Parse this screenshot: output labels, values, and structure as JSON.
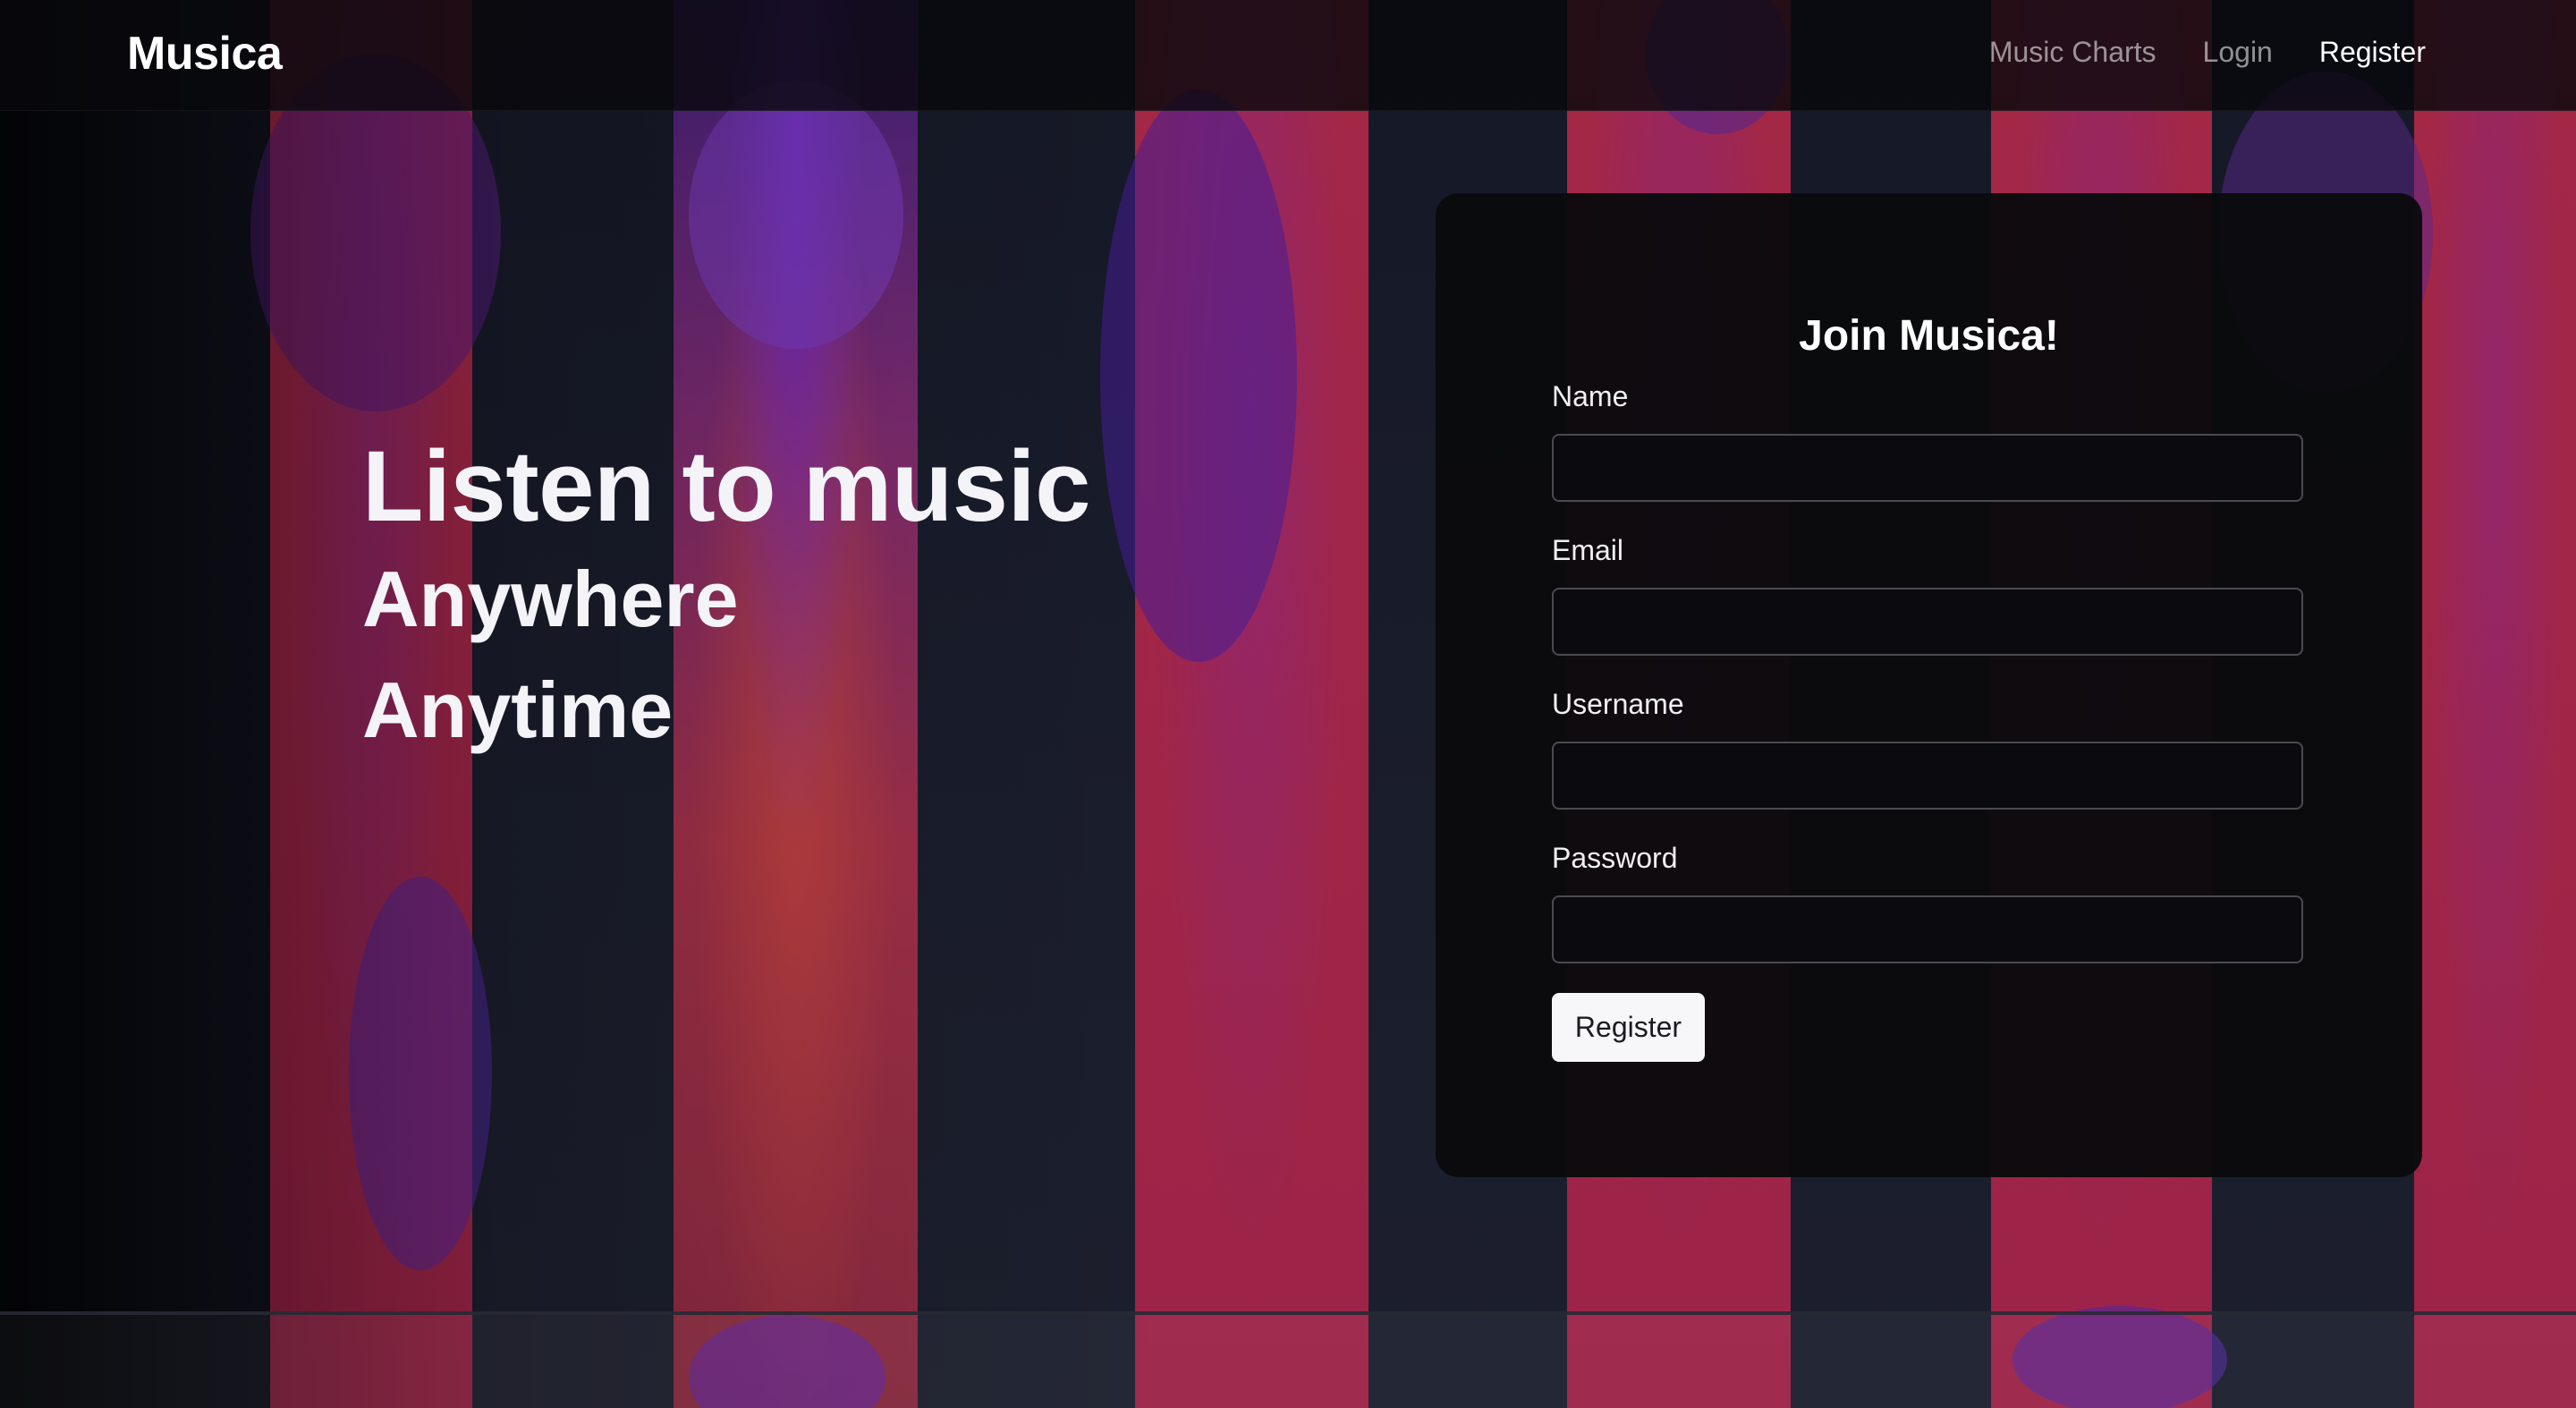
{
  "navbar": {
    "brand": "Musica",
    "links": [
      {
        "label": "Music Charts"
      },
      {
        "label": "Login"
      },
      {
        "label": "Register"
      }
    ]
  },
  "hero": {
    "title": "Listen to music",
    "line1": "Anywhere",
    "line2": "Anytime"
  },
  "form": {
    "title": "Join Musica!",
    "fields": [
      {
        "label": "Name",
        "value": ""
      },
      {
        "label": "Email",
        "value": ""
      },
      {
        "label": "Username",
        "value": ""
      },
      {
        "label": "Password",
        "value": ""
      }
    ],
    "submit_label": "Register"
  },
  "colors": {
    "accent_red": "#a12648",
    "accent_purple": "#5b2bd0",
    "card_bg": "#0a0a0d",
    "navbar_bg": "#08090c"
  }
}
